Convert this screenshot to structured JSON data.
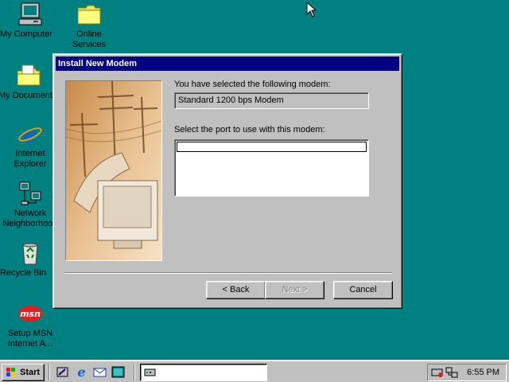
{
  "desktop": {
    "icons": [
      {
        "id": "my-computer",
        "label": "My Computer",
        "icon": "computer-icon"
      },
      {
        "id": "online-services",
        "label": "Online Services",
        "icon": "folder-icon"
      },
      {
        "id": "my-documents",
        "label": "My Documents",
        "icon": "documents-folder-icon"
      },
      {
        "id": "internet-explorer",
        "label": "Internet Explorer",
        "icon": "internet-explorer-icon"
      },
      {
        "id": "network-neighborhood",
        "label": "Network Neighborhood",
        "icon": "network-icon"
      },
      {
        "id": "recycle-bin",
        "label": "Recycle Bin",
        "icon": "recycle-bin-icon"
      },
      {
        "id": "setup-msn",
        "label": "Setup MSN Internet A...",
        "icon": "msn-icon"
      }
    ]
  },
  "dialog": {
    "title": "Install New Modem",
    "selected_label": "You have selected the following modem:",
    "selected_modem": "Standard  1200 bps Modem",
    "port_label": "Select the port to use with this modem:",
    "ports": [],
    "buttons": {
      "back": "< Back",
      "next": "Next >",
      "cancel": "Cancel"
    }
  },
  "taskbar": {
    "start_label": "Start",
    "quick_launch": [
      "show-desktop-icon",
      "ie-quicklaunch-icon",
      "outlook-express-icon",
      "channels-icon"
    ],
    "task_title": "",
    "clock": "6:55 PM"
  },
  "colors": {
    "desktop": "#008080",
    "titlebar": "#000080",
    "face": "#c0c0c0"
  }
}
